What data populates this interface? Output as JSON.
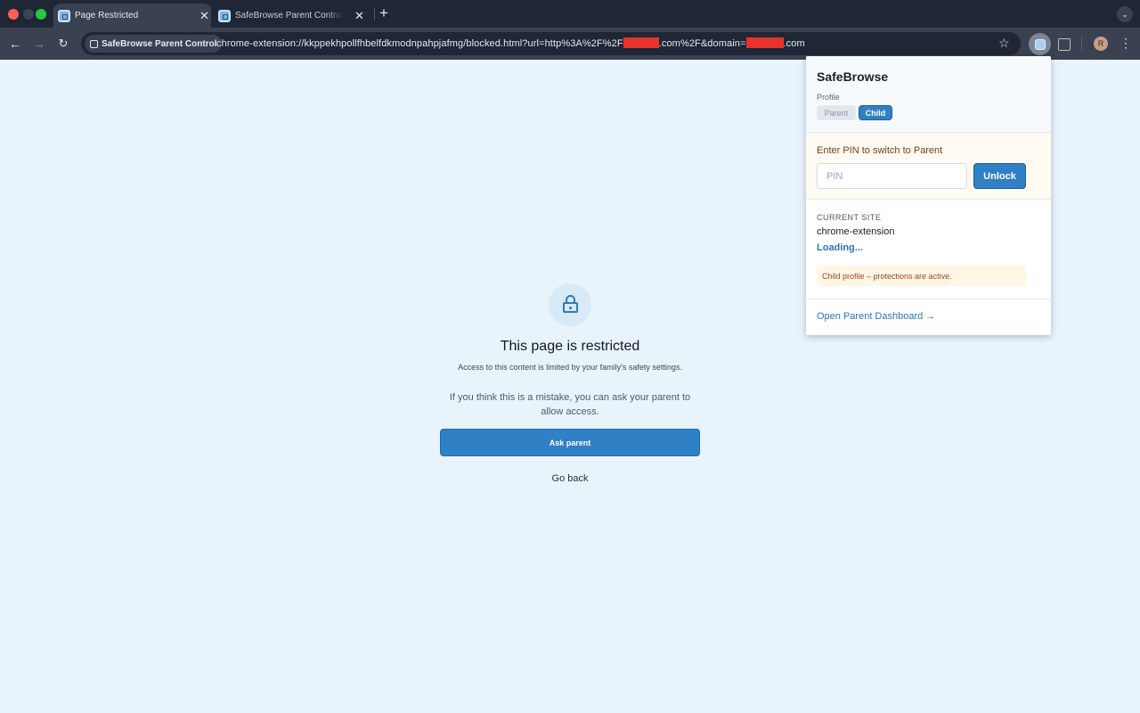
{
  "browser": {
    "tabs": [
      {
        "title": "Page Restricted",
        "active": true
      },
      {
        "title": "SafeBrowse Parent Control - ",
        "active": false
      }
    ],
    "new_tab": "+",
    "tab_search": "⌄",
    "site_chip": "SafeBrowse Parent Control",
    "url_parts": {
      "part1": "chrome-extension://kkppekhpollfhbelfdkmodnpahpjafmg/blocked.html?url=http%3A%2F%2F",
      "part2": ".com%2F&domain=",
      "part3": ".com"
    },
    "avatar_letter": "R"
  },
  "blocked_page": {
    "title": "This page is restricted",
    "subtitle": "Access to this content is limited by your family's safety settings.",
    "note": "If you think this is a mistake, you can ask your parent to allow access.",
    "ask_button": "Ask parent",
    "back_link": "Go back"
  },
  "popup": {
    "title": "SafeBrowse",
    "profile_label": "Profile",
    "profile_options": [
      "Parent",
      "Child"
    ],
    "selected_profile": "Child",
    "pin_prompt": "Enter PIN to switch to Parent",
    "pin_placeholder": "PIN",
    "unlock_button": "Unlock",
    "current_site_label": "CURRENT SITE",
    "current_site": "chrome-extension",
    "status": "Loading...",
    "notice": "Child profile – protections are active.",
    "dashboard_link": "Open Parent Dashboard →"
  },
  "colors": {
    "accent": "#2f80c4",
    "page_bg": "#e9f3fc",
    "chrome_dark": "#1f2636",
    "chrome_toolbar": "#3a4150",
    "warning_text": "#9a4a14",
    "redaction": "#e8322a"
  }
}
